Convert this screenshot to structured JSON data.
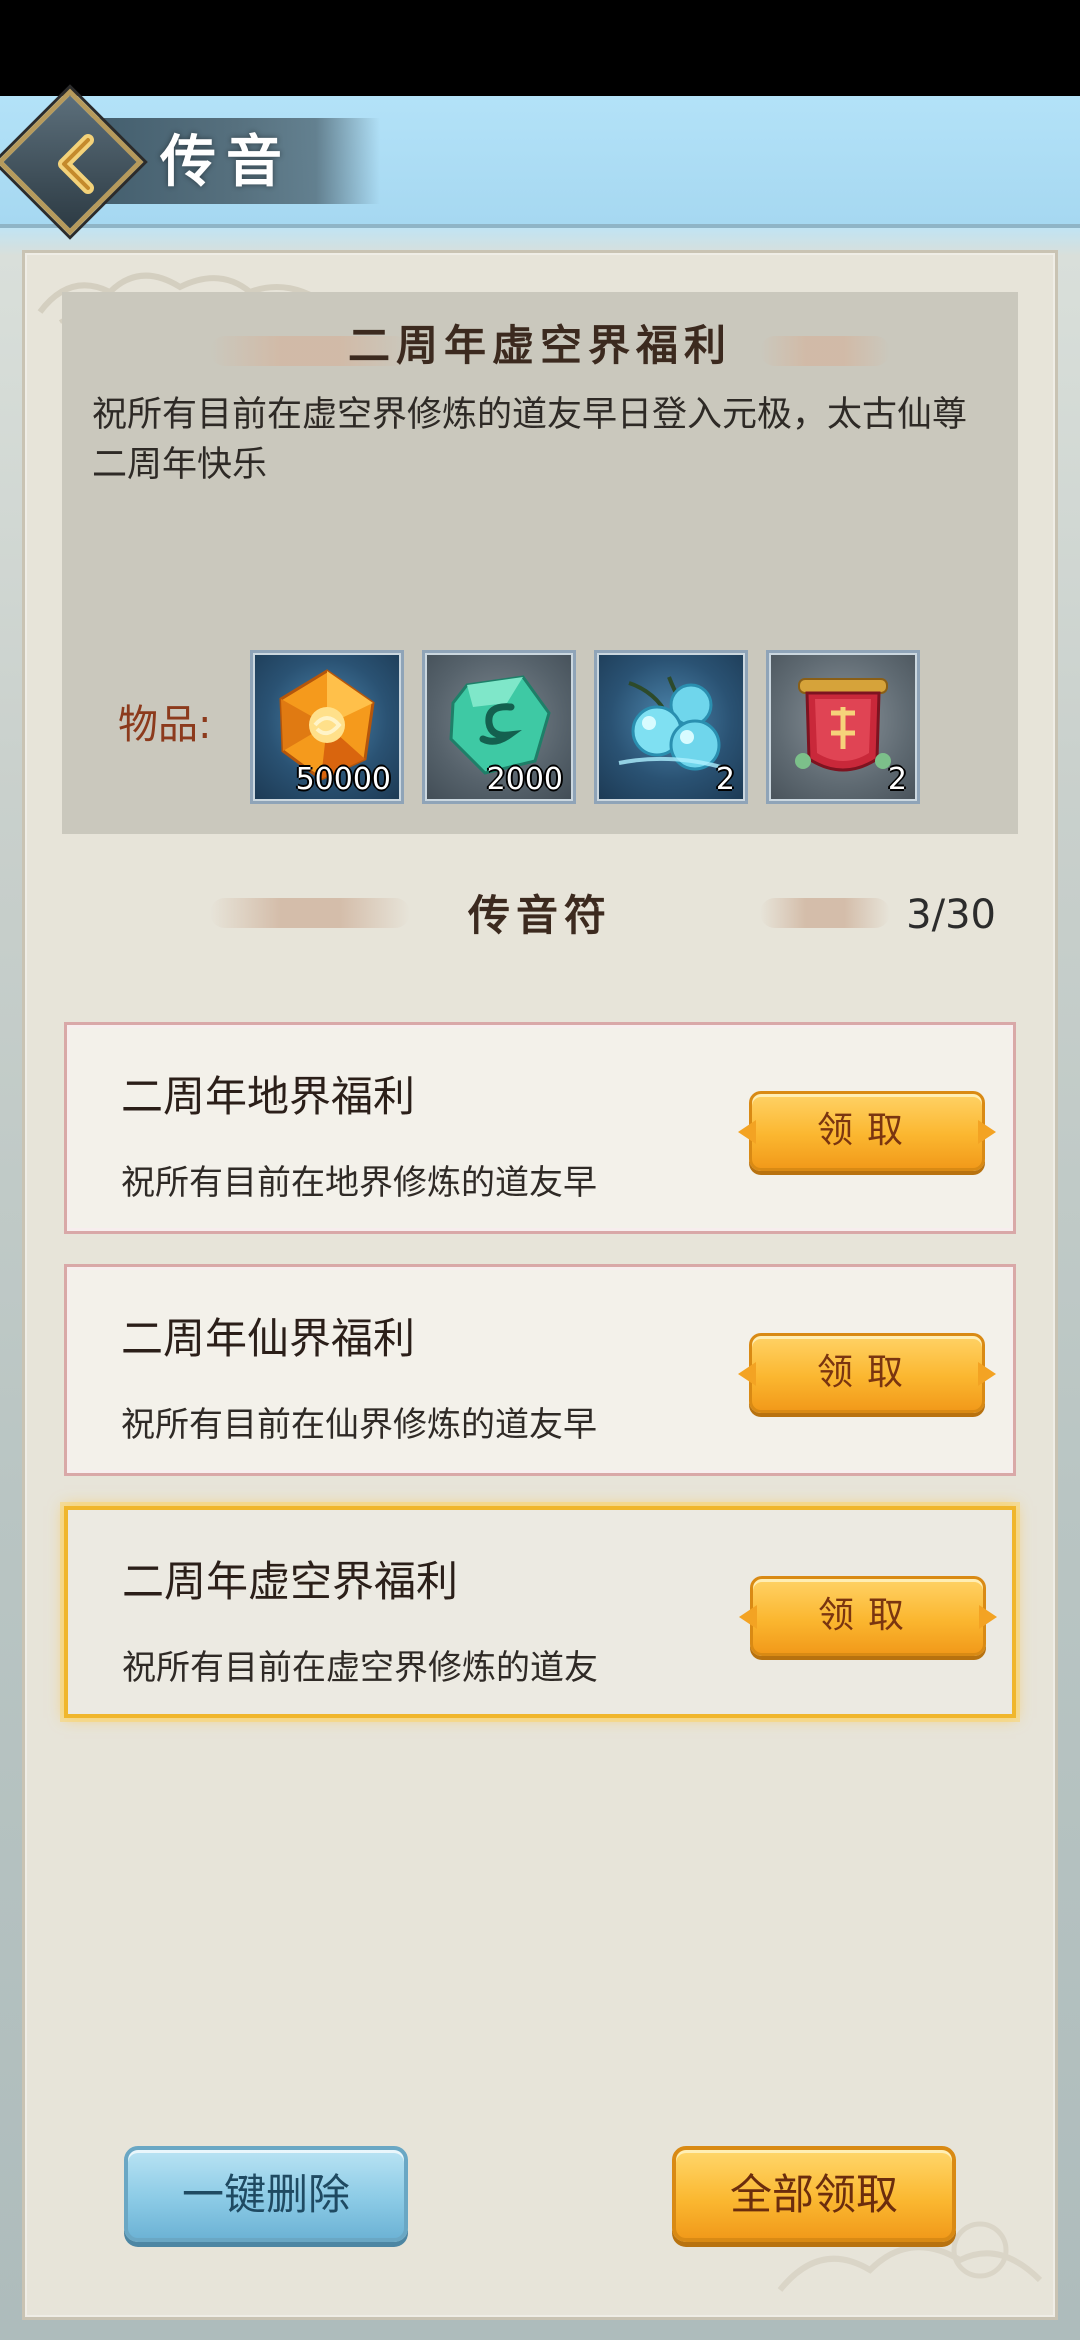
{
  "header": {
    "title": "传音",
    "back_icon": "chevron-left-icon"
  },
  "detail": {
    "title": "二周年虚空界福利",
    "body": "祝所有目前在虚空界修炼的道友早日登入元极，太古仙尊二周年快乐",
    "items_label": "物品:",
    "items": [
      {
        "icon": "orange-crystal-icon",
        "count": "50000"
      },
      {
        "icon": "jade-stone-icon",
        "count": "2000"
      },
      {
        "icon": "blue-fruit-icon",
        "count": "2"
      },
      {
        "icon": "red-scroll-icon",
        "count": "2"
      }
    ]
  },
  "section": {
    "title": "传音符",
    "count": "3/30"
  },
  "messages": [
    {
      "title": "二周年地界福利",
      "preview": "祝所有目前在地界修炼的道友早",
      "button": "领取",
      "selected": false
    },
    {
      "title": "二周年仙界福利",
      "preview": "祝所有目前在仙界修炼的道友早",
      "button": "领取",
      "selected": false
    },
    {
      "title": "二周年虚空界福利",
      "preview": "祝所有目前在虚空界修炼的道友",
      "button": "领取",
      "selected": true
    }
  ],
  "footer": {
    "delete_all": "一键删除",
    "claim_all": "全部领取"
  },
  "colors": {
    "accent_gold": "#fbb730",
    "accent_blue": "#8ccbe6",
    "selected_border": "#f0b62c",
    "card_border": "#d9a8a8",
    "items_label": "#8c3a1c"
  }
}
